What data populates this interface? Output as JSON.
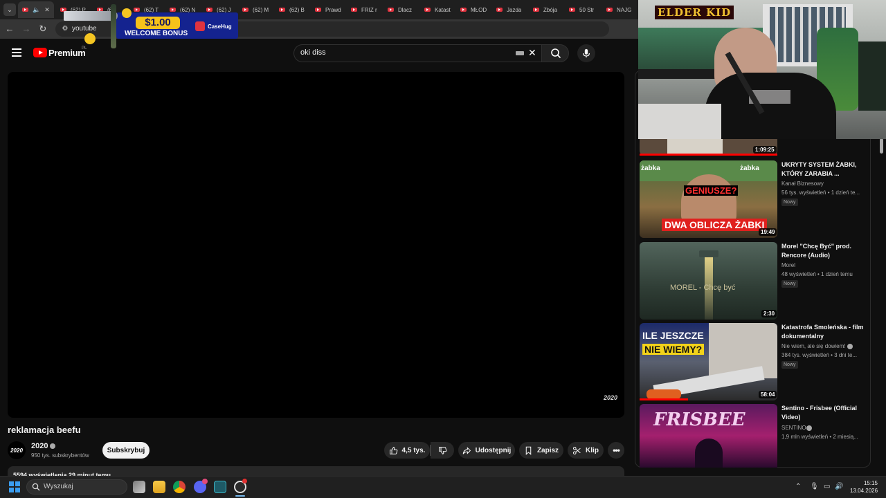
{
  "browser": {
    "tabs": [
      "(62) P",
      "(6",
      "(62) T",
      "(62) N",
      "(62) J",
      "(62) M",
      "(62) B",
      "Prawd",
      "FRIZ r",
      "Dlacz",
      "Katast",
      "MŁOD",
      "Jazda",
      "Zbója",
      "50 Str",
      "NAJG"
    ],
    "url": "youtube"
  },
  "ad": {
    "amount": "$1.00",
    "bonus": "WELCOME BONUS",
    "brand": "CaseHug"
  },
  "header": {
    "logo_text": "Premium",
    "region": "PL",
    "search_value": "oki diss"
  },
  "player": {
    "watermark": "2020"
  },
  "video": {
    "title": "reklamacja beefu",
    "channel": "2020",
    "channel_avatar": "2020",
    "subscribers": "950 tys. subskrybentów",
    "subscribe_label": "Subskrybuj",
    "likes": "4,5 tys.",
    "share_label": "Udostępnij",
    "save_label": "Zapisz",
    "clip_label": "Klip",
    "views_line": "5594 wyświetlenia  29 minut temu"
  },
  "stream": {
    "overlay_name": "ELDER KID"
  },
  "recommendations": [
    {
      "duration": "1:09:25"
    },
    {
      "title": "UKRYTY SYSTEM ŻABKI, KTÓRY ZARABIA ...",
      "channel": "Kanał Biznesowy",
      "meta": "56 tys. wyświetleń • 1 dzień te...",
      "badge": "Nowy",
      "duration": "19:49",
      "thumb_top": "GENIUSZE?",
      "thumb_bottom": "DWA OBLICZA ŻABKI",
      "thumb_sign": "żabka"
    },
    {
      "title": "Morel \"Chcę Być\" prod. Rencore (Audio)",
      "channel": "Morel",
      "meta": "48 wyświetleń • 1 dzień temu",
      "badge": "Nowy",
      "duration": "2:30",
      "thumb_text": "MOREL - Chcę być"
    },
    {
      "title": "Katastrofa Smoleńska - film dokumentalny",
      "channel": "Nie wiem, ale się dowiem!",
      "meta": "384 tys. wyświetleń • 3 dni te...",
      "badge": "Nowy",
      "duration": "58:04",
      "thumb_text_1": "ILE JESZCZE",
      "thumb_text_2": "NIE WIEMY?"
    },
    {
      "title": "Sentino - Frisbee (Official Video)",
      "channel": "SENTINO",
      "meta": "1,9 mln wyświetleń • 2 miesią...",
      "thumb_text": "FRISBEE"
    }
  ],
  "taskbar": {
    "search_placeholder": "Wyszukaj",
    "time": "15:15",
    "date": "13.04.2026"
  }
}
